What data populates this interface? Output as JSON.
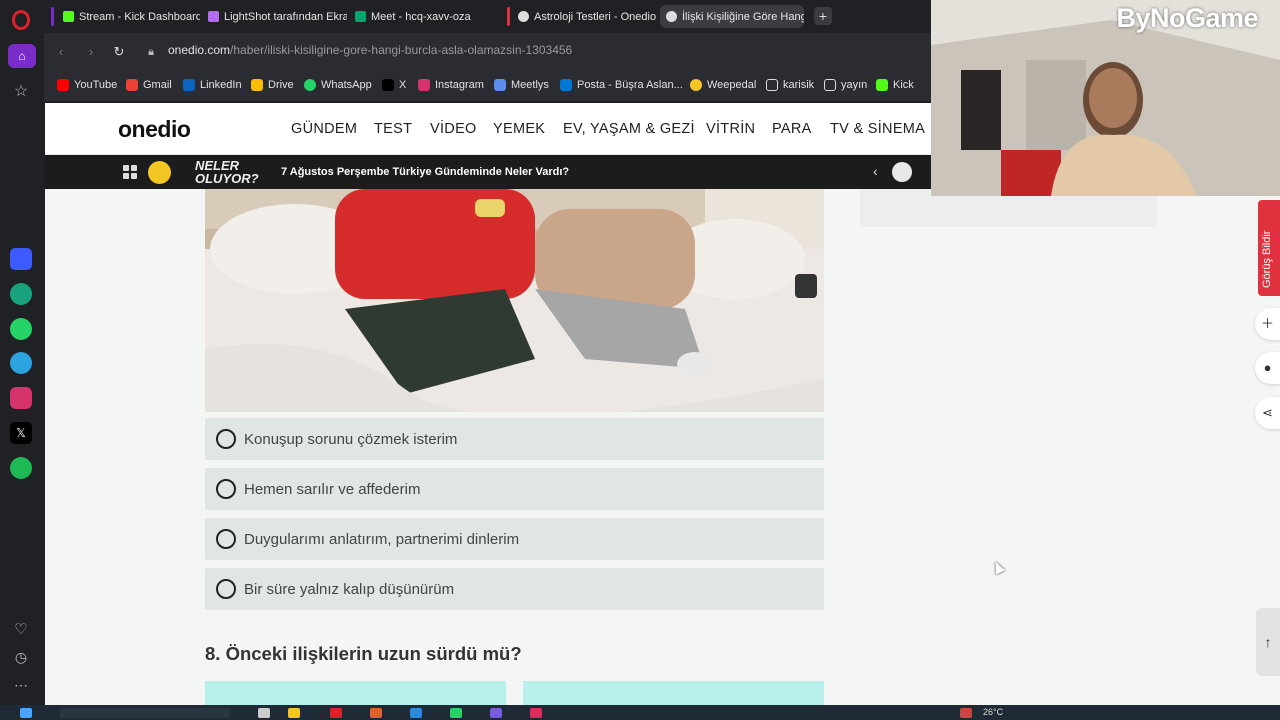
{
  "browser": {
    "tabs": [
      {
        "label": "Stream - Kick Dashboard",
        "active": false
      },
      {
        "label": "LightShot tarafından Ekran",
        "active": false
      },
      {
        "label": "Meet - hcq-xavv-oza",
        "active": false
      },
      {
        "label": "Astroloji Testleri - Onedio",
        "active": false
      },
      {
        "label": "İlişki Kişiliğine Göre Hang",
        "active": true
      }
    ],
    "new_tab_label": "+",
    "url": {
      "host": "onedio.com",
      "path": "/haber/iliski-kisiligine-gore-hangi-burcla-asla-olamazsin-1303456"
    },
    "bookmarks": [
      {
        "label": "YouTube",
        "icon": "youtube-icon"
      },
      {
        "label": "Gmail",
        "icon": "gmail-icon"
      },
      {
        "label": "LinkedIn",
        "icon": "linkedin-icon"
      },
      {
        "label": "Drive",
        "icon": "drive-icon"
      },
      {
        "label": "WhatsApp",
        "icon": "whatsapp-icon"
      },
      {
        "label": "X",
        "icon": "x-icon"
      },
      {
        "label": "Instagram",
        "icon": "instagram-icon"
      },
      {
        "label": "Meetlys",
        "icon": "meetlys-icon"
      },
      {
        "label": "Posta - Büşra Aslan...",
        "icon": "outlook-icon"
      },
      {
        "label": "Weepedal",
        "icon": "weepedal-icon"
      },
      {
        "label": "karisik",
        "icon": "folder-icon"
      },
      {
        "label": "yayın",
        "icon": "folder-icon"
      },
      {
        "label": "Kick",
        "icon": "kick-icon"
      }
    ]
  },
  "site": {
    "logo": "onedio",
    "nav": [
      "GÜNDEM",
      "TEST",
      "VİDEO",
      "YEMEK",
      "EV, YAŞAM & GEZİ",
      "VİTRİN",
      "PARA",
      "TV & SİNEMA"
    ],
    "newsbar": {
      "label_line1": "NELER",
      "label_line2": "OLUYOR?",
      "headline": "7 Ağustos Perşembe Türkiye Gündeminde Neler Vardı?"
    }
  },
  "quiz": {
    "options": [
      "Konuşup sorunu çözmek isterim",
      "Hemen sarılır ve affederim",
      "Duygularımı anlatırım, partnerimi dinlerim",
      "Bir süre yalnız kalıp düşünürüm"
    ],
    "next_question": "8. Önceki ilişkilerin uzun sürdü mü?"
  },
  "side": {
    "feedback_label": "Görüş Bildir"
  },
  "overlay": {
    "brand": "ByNoGame"
  },
  "taskbar": {
    "temperature": "26°C"
  },
  "colors": {
    "option_bg": "#dfe6e3",
    "answer_box": "#b8f0ec",
    "feedback": "#e0313e",
    "newsbar_bg": "#1c1c1c"
  }
}
